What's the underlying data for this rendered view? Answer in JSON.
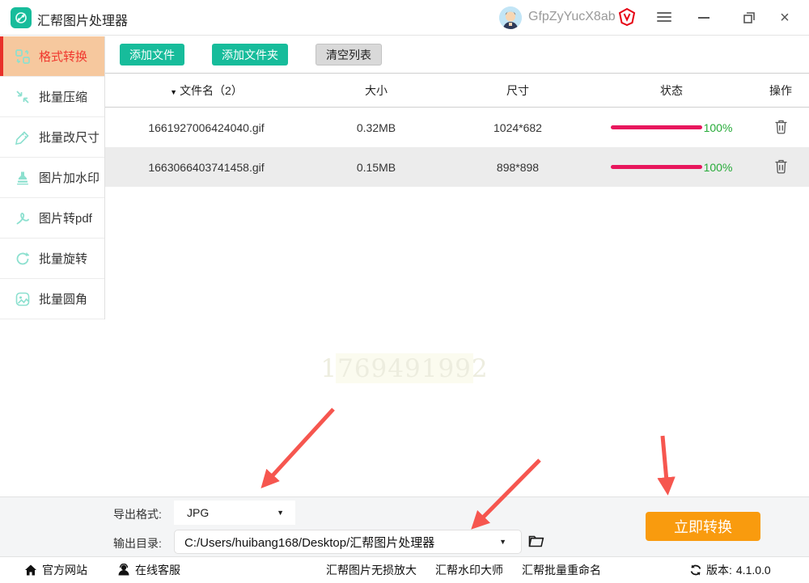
{
  "titlebar": {
    "app_title": "汇帮图片处理器",
    "username": "GfpZyYucX8ab"
  },
  "sidebar": {
    "items": [
      {
        "label": "格式转换",
        "active": true
      },
      {
        "label": "批量压缩",
        "active": false
      },
      {
        "label": "批量改尺寸",
        "active": false
      },
      {
        "label": "图片加水印",
        "active": false
      },
      {
        "label": "图片转pdf",
        "active": false
      },
      {
        "label": "批量旋转",
        "active": false
      },
      {
        "label": "批量圆角",
        "active": false
      }
    ]
  },
  "toolbar": {
    "add_file": "添加文件",
    "add_folder": "添加文件夹",
    "clear_list": "清空列表"
  },
  "table": {
    "headers": {
      "name": "文件名（2）",
      "size": "大小",
      "dims": "尺寸",
      "status": "状态",
      "ops": "操作"
    },
    "rows": [
      {
        "name": "1661927006424040.gif",
        "size": "0.32MB",
        "dims": "1024*682",
        "progress": 100,
        "progress_text": "100%"
      },
      {
        "name": "1663066403741458.gif",
        "size": "0.15MB",
        "dims": "898*898",
        "progress": 100,
        "progress_text": "100%"
      }
    ]
  },
  "watermark": "1769491992",
  "output_panel": {
    "format_label": "导出格式:",
    "format_value": "JPG",
    "dir_label": "输出目录:",
    "dir_value": "C:/Users/huibang168/Desktop/汇帮图片处理器",
    "convert_button": "立即转换"
  },
  "statusbar": {
    "official_site": "官方网站",
    "online_service": "在线客服",
    "links": [
      "汇帮图片无损放大",
      "汇帮水印大师",
      "汇帮批量重命名"
    ],
    "version_label": "版本:",
    "version": "4.1.0.0"
  },
  "colors": {
    "brand_teal": "#17bc9b",
    "sidebar_icon_teal": "#8ce0cf",
    "active_peach": "#f6c89e",
    "active_red": "#f0382e",
    "progress_pink": "#e8175d",
    "success_green": "#27ab39",
    "accent_orange": "#f99b0e",
    "arrow_red": "#f6564f"
  }
}
